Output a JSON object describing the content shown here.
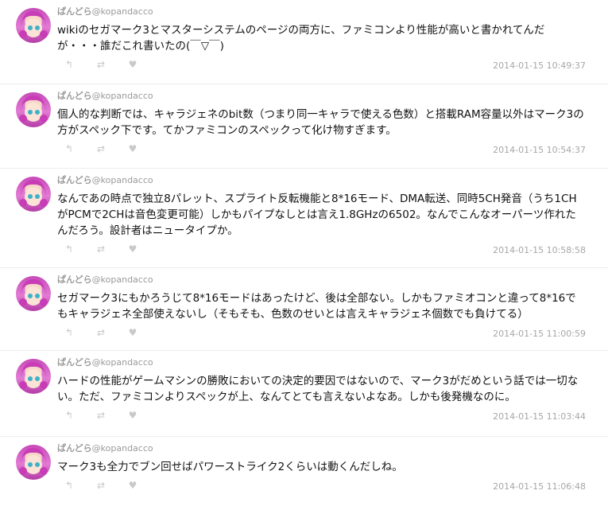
{
  "tweets": [
    {
      "display_name": "ぱんどら",
      "handle": "@kopandacco",
      "text": "wikiのセガマーク3とマスターシステムのページの両方に、ファミコンより性能が高いと書かれてんだが・・・誰だこれ書いたの(￣▽￣)",
      "timestamp": "2014-01-15 10:49:37"
    },
    {
      "display_name": "ぱんどら",
      "handle": "@kopandacco",
      "text": "個人的な判断では、キャラジェネのbit数（つまり同一キャラで使える色数）と搭載RAM容量以外はマーク3の方がスペック下です。てかファミコンのスペックって化け物すぎます。",
      "timestamp": "2014-01-15 10:54:37"
    },
    {
      "display_name": "ぱんどら",
      "handle": "@kopandacco",
      "text": "なんであの時点で独立8パレット、スプライト反転機能と8*16モード、DMA転送、同時5CH発音（うち1CHがPCMで2CHは音色変更可能）しかもパイプなしとは言え1.8GHzの6502。なんでこんなオーパーツ作れたんだろう。設計者はニュータイプか。",
      "timestamp": "2014-01-15 10:58:58"
    },
    {
      "display_name": "ぱんどら",
      "handle": "@kopandacco",
      "text": "セガマーク3にもかろうじて8*16モードはあったけど、後は全部ない。しかもファミオコンと違って8*16でもキャラジェネ全部使えないし（そもそも、色数のせいとは言えキャラジェネ個数でも負けてる）",
      "timestamp": "2014-01-15 11:00:59"
    },
    {
      "display_name": "ぱんどら",
      "handle": "@kopandacco",
      "text": "ハードの性能がゲームマシンの勝敗においての決定的要因ではないので、マーク3がだめという話では一切ない。ただ、ファミコンよりスペックが上、なんてとても言えないよなあ。しかも後発機なのに。",
      "timestamp": "2014-01-15 11:03:44"
    },
    {
      "display_name": "ぱんどら",
      "handle": "@kopandacco",
      "text": "マーク3も全力でブン回せばパワーストライク2くらいは動くんだしね。",
      "timestamp": "2014-01-15 11:06:48"
    }
  ],
  "icons": {
    "reply": "reply-icon",
    "retweet": "retweet-icon",
    "favorite": "heart-icon"
  },
  "colors": {
    "name": "#9a9a9a",
    "timestamp": "#a7a7a7",
    "action_icons": "#c9c9c9",
    "divider": "#ededed"
  }
}
